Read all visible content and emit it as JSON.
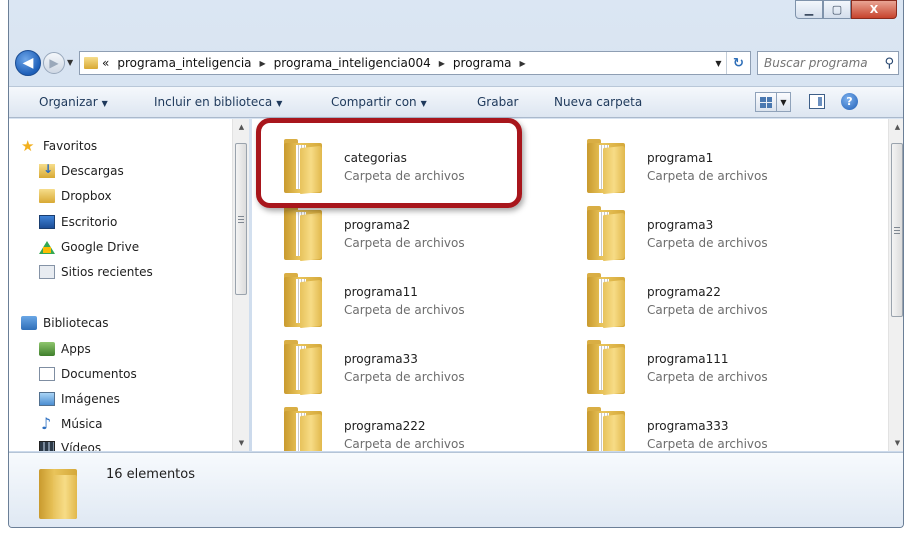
{
  "window": {
    "caption": {
      "minimize": "▁",
      "maximize": "▢",
      "close": "X"
    }
  },
  "address": {
    "back_glyph": "◀",
    "forward_glyph": "▶",
    "overflow": "«",
    "crumbs": [
      "programa_inteligencia",
      "programa_inteligencia004",
      "programa"
    ],
    "refresh_glyph": "↻"
  },
  "search": {
    "placeholder": "Buscar programa"
  },
  "toolbar": {
    "organize": "Organizar",
    "include_library": "Incluir en biblioteca",
    "share_with": "Compartir con",
    "burn": "Grabar",
    "new_folder": "Nueva carpeta",
    "help": "?"
  },
  "navpane": {
    "items": [
      {
        "label": "Favoritos",
        "icon": "star-icon"
      },
      {
        "label": "Descargas",
        "icon": "downloads-icon"
      },
      {
        "label": "Dropbox",
        "icon": "folder-icon"
      },
      {
        "label": "Escritorio",
        "icon": "desktop-icon"
      },
      {
        "label": "Google Drive",
        "icon": "google-drive-icon"
      },
      {
        "label": "Sitios recientes",
        "icon": "recent-places-icon"
      },
      {
        "label": "Bibliotecas",
        "icon": "libraries-icon"
      },
      {
        "label": "Apps",
        "icon": "apps-icon"
      },
      {
        "label": "Documentos",
        "icon": "documents-icon"
      },
      {
        "label": "Imágenes",
        "icon": "pictures-icon"
      },
      {
        "label": "Música",
        "icon": "music-icon"
      },
      {
        "label": "Vídeos",
        "icon": "videos-icon"
      }
    ]
  },
  "files": [
    {
      "name": "categorias",
      "type": "Carpeta de archivos"
    },
    {
      "name": "programa1",
      "type": "Carpeta de archivos"
    },
    {
      "name": "programa2",
      "type": "Carpeta de archivos"
    },
    {
      "name": "programa3",
      "type": "Carpeta de archivos"
    },
    {
      "name": "programa11",
      "type": "Carpeta de archivos"
    },
    {
      "name": "programa22",
      "type": "Carpeta de archivos"
    },
    {
      "name": "programa33",
      "type": "Carpeta de archivos"
    },
    {
      "name": "programa111",
      "type": "Carpeta de archivos"
    },
    {
      "name": "programa222",
      "type": "Carpeta de archivos"
    },
    {
      "name": "programa333",
      "type": "Carpeta de archivos"
    }
  ],
  "details": {
    "count": "16 elementos"
  },
  "colors": {
    "highlight": "#a8161c",
    "accent": "#1e395b"
  }
}
